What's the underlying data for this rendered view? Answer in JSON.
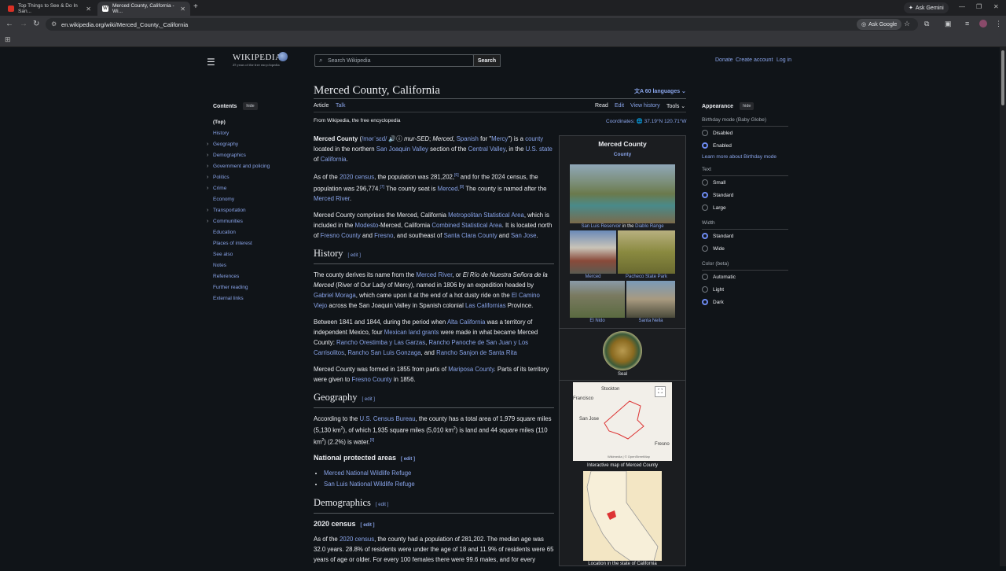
{
  "browser": {
    "tabs": [
      {
        "title": "Top Things to See & Do In San...",
        "active": false
      },
      {
        "title": "Merced County, California - Wi...",
        "active": true
      }
    ],
    "gemini": "Ask Gemini",
    "url": "en.wikipedia.org/wiki/Merced_County,_California",
    "ask_google": "Ask Google"
  },
  "header": {
    "wordmark": "WIKIPEDIA",
    "tagline": "25 years of the free encyclopedia",
    "search_placeholder": "Search Wikipedia",
    "search_button": "Search",
    "links": {
      "donate": "Donate",
      "create": "Create account",
      "login": "Log in"
    }
  },
  "toc": {
    "title": "Contents",
    "hide": "hide",
    "items": [
      {
        "label": "(Top)",
        "expandable": false
      },
      {
        "label": "History",
        "expandable": false
      },
      {
        "label": "Geography",
        "expandable": true
      },
      {
        "label": "Demographics",
        "expandable": true
      },
      {
        "label": "Government and policing",
        "expandable": true
      },
      {
        "label": "Politics",
        "expandable": true
      },
      {
        "label": "Crime",
        "expandable": true
      },
      {
        "label": "Economy",
        "expandable": false
      },
      {
        "label": "Transportation",
        "expandable": true
      },
      {
        "label": "Communities",
        "expandable": true
      },
      {
        "label": "Education",
        "expandable": false
      },
      {
        "label": "Places of interest",
        "expandable": false
      },
      {
        "label": "See also",
        "expandable": false
      },
      {
        "label": "Notes",
        "expandable": false
      },
      {
        "label": "References",
        "expandable": false
      },
      {
        "label": "Further reading",
        "expandable": false
      },
      {
        "label": "External links",
        "expandable": false
      }
    ]
  },
  "article": {
    "title": "Merced County, California",
    "languages": "60 languages",
    "tabs": {
      "article": "Article",
      "talk": "Talk",
      "read": "Read",
      "edit": "Edit",
      "history": "View history",
      "tools": "Tools"
    },
    "from": "From Wikipedia, the free encyclopedia",
    "coordinates_label": "Coordinates:",
    "coordinates": "37.19°N 120.71°W",
    "edit_label": "edit",
    "sections": {
      "history": "History",
      "geography": "Geography",
      "protected": "National protected areas",
      "demographics": "Demographics",
      "census2020": "2020 census"
    },
    "refuges": [
      "Merced National Wildlife Refuge",
      "San Luis National Wildlife Refuge"
    ]
  },
  "infobox": {
    "title": "Merced County",
    "subtitle": "County",
    "caption_main_a": "San Luis Reservoir",
    "caption_main_b": " in the ",
    "caption_main_c": "Diablo Range",
    "captions": [
      "Merced",
      "Pacheco State Park",
      "El Nido",
      "Santa Nella"
    ],
    "seal": "Seal",
    "map_labels": [
      "Stockton",
      "Francisco",
      "San Jose",
      "Fresno"
    ],
    "map_attrib": "Wikimedia | © OpenStreetMap",
    "map_caption": "Interactive map of Merced County",
    "location_caption": "Location in the state of California"
  },
  "appearance": {
    "title": "Appearance",
    "hide": "hide",
    "birthday_label": "Birthday mode (Baby Globe)",
    "birthday_opts": [
      {
        "label": "Disabled",
        "on": false
      },
      {
        "label": "Enabled",
        "on": true
      }
    ],
    "birthday_link": "Learn more about Birthday mode",
    "text_label": "Text",
    "text_opts": [
      {
        "label": "Small",
        "on": false
      },
      {
        "label": "Standard",
        "on": true
      },
      {
        "label": "Large",
        "on": false
      }
    ],
    "width_label": "Width",
    "width_opts": [
      {
        "label": "Standard",
        "on": true
      },
      {
        "label": "Wide",
        "on": false
      }
    ],
    "color_label": "Color (beta)",
    "color_opts": [
      {
        "label": "Automatic",
        "on": false
      },
      {
        "label": "Light",
        "on": false
      },
      {
        "label": "Dark",
        "on": true
      }
    ]
  },
  "colors": {
    "link": "#88a3e8",
    "background": "#101418",
    "accent": "#6d8af0"
  }
}
